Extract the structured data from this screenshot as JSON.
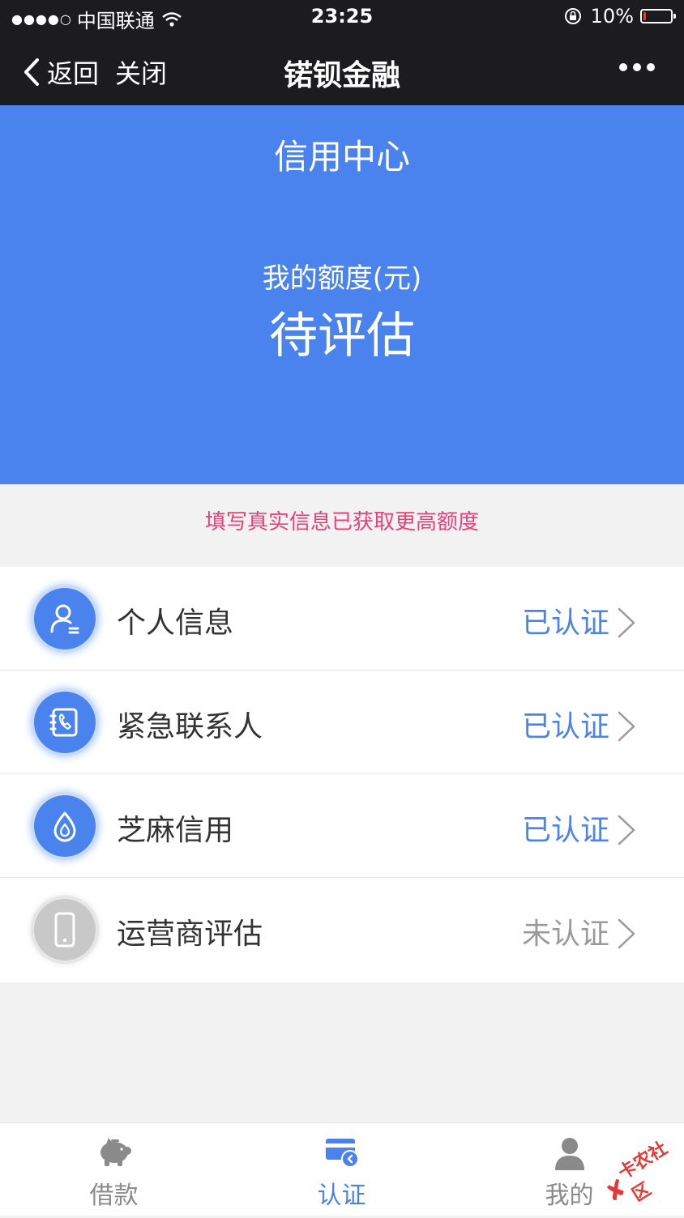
{
  "status_bar": {
    "signal": "●●●●○",
    "carrier": "中国联通",
    "time": "23:25",
    "battery_percent": "10%",
    "battery_level": 0.1
  },
  "nav": {
    "back_label": "返回",
    "close_label": "关闭",
    "title": "锘钡金融"
  },
  "hero": {
    "title": "信用中心",
    "quota_label": "我的额度(元)",
    "quota_value": "待评估"
  },
  "tip": "填写真实信息已获取更高额度",
  "cert_items": [
    {
      "name": "个人信息",
      "status": "已认证",
      "icon": "person-icon"
    },
    {
      "name": "紧急联系人",
      "status": "已认证",
      "icon": "phone-contact-icon"
    },
    {
      "name": "芝麻信用",
      "status": "已认证",
      "icon": "sesame-drop-icon"
    },
    {
      "name": "运营商评估",
      "status": "未认证",
      "icon": "mobile-phone-icon"
    }
  ],
  "tabs": [
    {
      "label": "借款",
      "icon": "piggy-bank-icon"
    },
    {
      "label": "认证",
      "icon": "card-verify-icon",
      "active": true
    },
    {
      "label": "我的",
      "icon": "user-icon"
    }
  ],
  "watermark": "卡农社区",
  "colors": {
    "brand_blue": "#4a82ee",
    "tip_pink": "#ec3f7a",
    "nav_dark": "#1c1c1e"
  }
}
